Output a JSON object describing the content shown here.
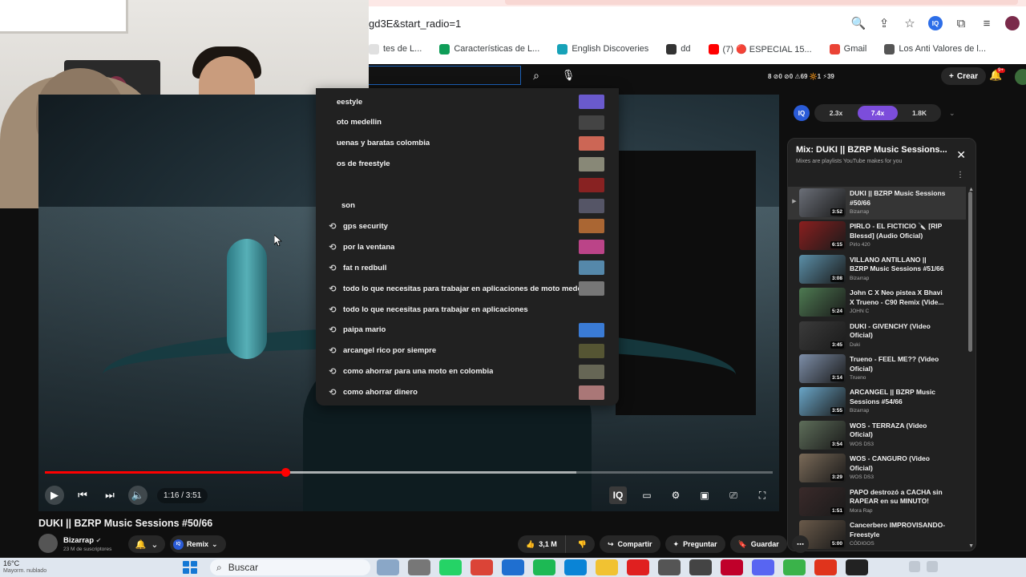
{
  "browser": {
    "url": "gd3E&start_radio=1",
    "bookmarks": [
      {
        "label": "tes de L...",
        "color": "#e0e0e0"
      },
      {
        "label": "Características de L...",
        "color": "#0f9d58"
      },
      {
        "label": "English Discoveries",
        "color": "#17a2b8"
      },
      {
        "label": "dd",
        "color": "#333333"
      },
      {
        "label": "(7) 🔴 ESPECIAL 15...",
        "color": "#ff0000"
      },
      {
        "label": "Gmail",
        "color": "#ea4335"
      },
      {
        "label": "Los Anti Valores de l...",
        "color": "#555555"
      }
    ]
  },
  "search": {
    "suggestions": [
      {
        "text": "eestyle",
        "thumb": "#6a5acd"
      },
      {
        "text": "oto medellin",
        "thumb": "#444"
      },
      {
        "text": "uenas y baratas colombia",
        "thumb": "#c65"
      },
      {
        "text": "os de freestyle",
        "thumb": "#887"
      },
      {
        "text": "",
        "thumb": "#822"
      },
      {
        "text": "son",
        "thumb": "#556"
      },
      {
        "text": "gps security",
        "thumb": "#a63"
      },
      {
        "text": "por la ventana",
        "thumb": "#b48"
      },
      {
        "text": "fat n redbull",
        "thumb": "#58a"
      },
      {
        "text": "todo lo que necesitas para trabajar en aplicaciones de moto medellin",
        "thumb": "#777"
      },
      {
        "text": "todo lo que necesitas para trabajar en aplicaciones",
        "thumb": ""
      },
      {
        "text": "paipa mario",
        "thumb": "#3a7bd5"
      },
      {
        "text": "arcangel rico por siempre",
        "thumb": "#553"
      },
      {
        "text": "como ahorrar para una moto en colombia",
        "thumb": "#665"
      },
      {
        "text": "como ahorrar dinero",
        "thumb": "#a77"
      }
    ]
  },
  "header": {
    "stats": "8 ⊘0 ⊘0 ⚠69 🔆1 ⚡39",
    "create_label": "Crear",
    "notif_count": "9+"
  },
  "speed": {
    "iq": "IQ",
    "options": [
      "2.3x",
      "7.4x",
      "1.8K"
    ],
    "active_index": 1
  },
  "player": {
    "time": "1:16 / 3:51",
    "progress": 0.33,
    "buffered": 0.73
  },
  "video": {
    "title": "DUKI || BZRP Music Sessions #50/66",
    "channel": "Bizarrap",
    "subscribers": "23 M de suscriptores",
    "remix_label": "Remix",
    "likes": "3,1 M",
    "share_label": "Compartir",
    "ask_label": "Preguntar",
    "save_label": "Guardar"
  },
  "playlist": {
    "title": "Mix: DUKI || BZRP Music Sessions...",
    "subtitle": "Mixes are playlists YouTube makes for you",
    "items": [
      {
        "title": "DUKI || BZRP Music Sessions #50/66",
        "channel": "Bizarrap",
        "duration": "3:52",
        "thumb": "#6b6f78",
        "current": true
      },
      {
        "title": "PIRLO - EL FICTICIO 🔪 [RIP Blessd] (Audio Oficial)",
        "channel": "Pirlo 420",
        "duration": "6:15",
        "thumb": "#8a1f1f",
        "current": false
      },
      {
        "title": "VILLANO ANTILLANO || BZRP Music Sessions #51/66",
        "channel": "Bizarrap",
        "duration": "3:08",
        "thumb": "#5b8fa8",
        "current": false
      },
      {
        "title": "John C X Neo pistea X Bhavi X Trueno - C90 Remix (Vide...",
        "channel": "JOHN C",
        "duration": "5:24",
        "thumb": "#4e7a52",
        "current": false
      },
      {
        "title": "DUKI - GIVENCHY (Video Oficial)",
        "channel": "Duki",
        "duration": "3:45",
        "thumb": "#3b3b3b",
        "current": false
      },
      {
        "title": "Trueno - FEEL ME?? (Video Oficial)",
        "channel": "Trueno",
        "duration": "3:14",
        "thumb": "#7d8ea8",
        "current": false
      },
      {
        "title": "ARCANGEL || BZRP Music Sessions #54/66",
        "channel": "Bizarrap",
        "duration": "3:55",
        "thumb": "#6aa6c8",
        "current": false
      },
      {
        "title": "WOS - TERRAZA (Video Oficial)",
        "channel": "WOS DS3",
        "duration": "3:54",
        "thumb": "#5e6e5a",
        "current": false
      },
      {
        "title": "WOS - CANGURO (Video Oficial)",
        "channel": "WOS DS3",
        "duration": "3:29",
        "thumb": "#7a6a58",
        "current": false
      },
      {
        "title": "PAPO destrozó a CACHA sin RAPEAR en su MINUTO!",
        "channel": "Mora Rap",
        "duration": "1:51",
        "thumb": "#3a2a2a",
        "current": false
      },
      {
        "title": "Cancerbero IMPROVISANDO- Freestyle",
        "channel": "CÓDIGOS",
        "duration": "5:00",
        "thumb": "#6a5a4a",
        "current": false
      }
    ]
  },
  "taskbar": {
    "temp": "16°C",
    "weather": "Mayorm. nublado",
    "search_label": "Buscar"
  }
}
